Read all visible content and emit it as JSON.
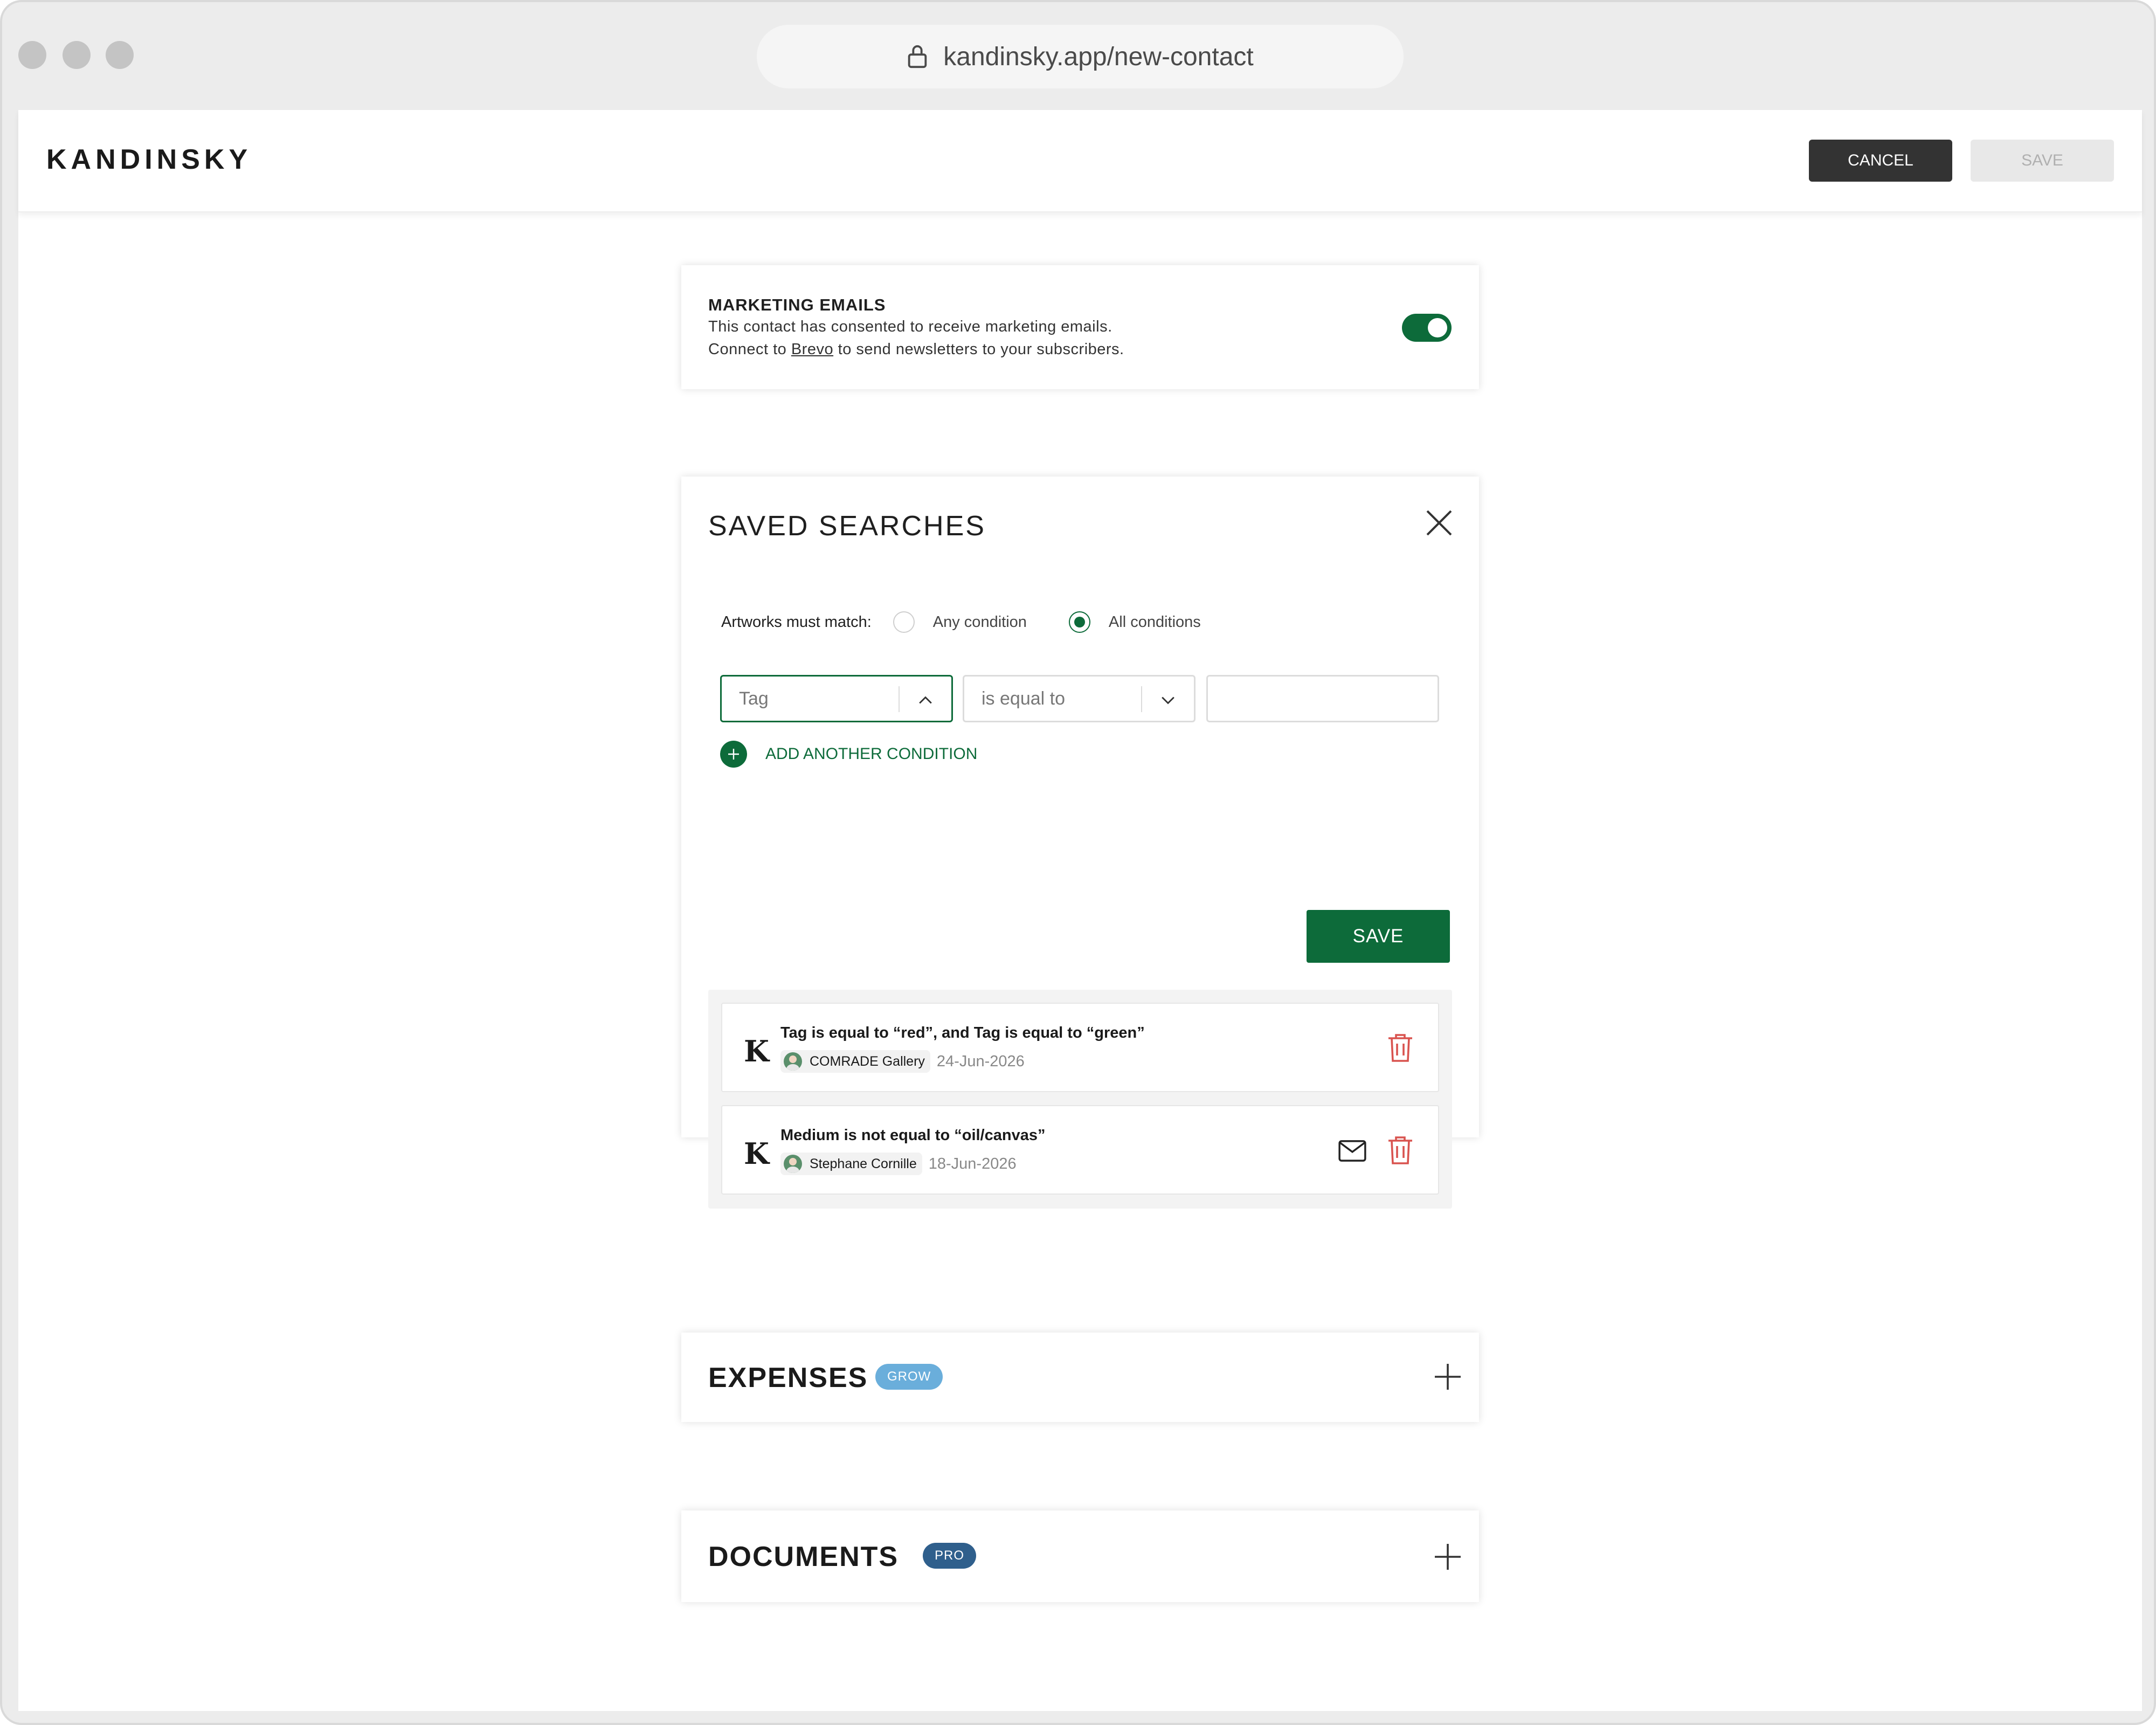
{
  "browser": {
    "url": "kandinsky.app/new-contact"
  },
  "app": {
    "logo": "KANDINSKY",
    "cancel_label": "CANCEL",
    "save_label": "SAVE"
  },
  "marketing": {
    "title": "MARKETING EMAILS",
    "line1": "This contact has consented to receive marketing emails.",
    "line2_prefix": "Connect to ",
    "line2_link": "Brevo",
    "line2_suffix": " to send newsletters to your subscribers.",
    "toggle_on": true,
    "accent": "#0d6b3a"
  },
  "saved_searches": {
    "title": "SAVED SEARCHES",
    "match_label": "Artworks must match:",
    "options": [
      "Any condition",
      "All conditions"
    ],
    "selected_option": "All conditions",
    "condition": {
      "field": "Tag",
      "operator": "is equal to",
      "value": ""
    },
    "add_condition_label": "ADD ANOTHER CONDITION",
    "save_label": "SAVE",
    "results": [
      {
        "title": "Tag is equal to “red”, and Tag is equal to “green”",
        "owner": "COMRADE Gallery",
        "date": "24-Jun-2026",
        "icons": [
          "trash-icon"
        ]
      },
      {
        "title": "Medium is not equal to “oil/canvas”",
        "owner": "Stephane Cornille",
        "date": "18-Jun-2026",
        "icons": [
          "mail-icon",
          "trash-icon"
        ]
      }
    ],
    "result_logo": "K"
  },
  "expenses": {
    "title": "EXPENSES",
    "badge": "GROW",
    "badge_color": "#6aaedb"
  },
  "documents": {
    "title": "DOCUMENTS",
    "badge": "PRO",
    "badge_color": "#2f5f8c"
  },
  "colors": {
    "primary_green": "#0d6b3a",
    "danger_red": "#d9534f",
    "dark_button": "#333333"
  }
}
